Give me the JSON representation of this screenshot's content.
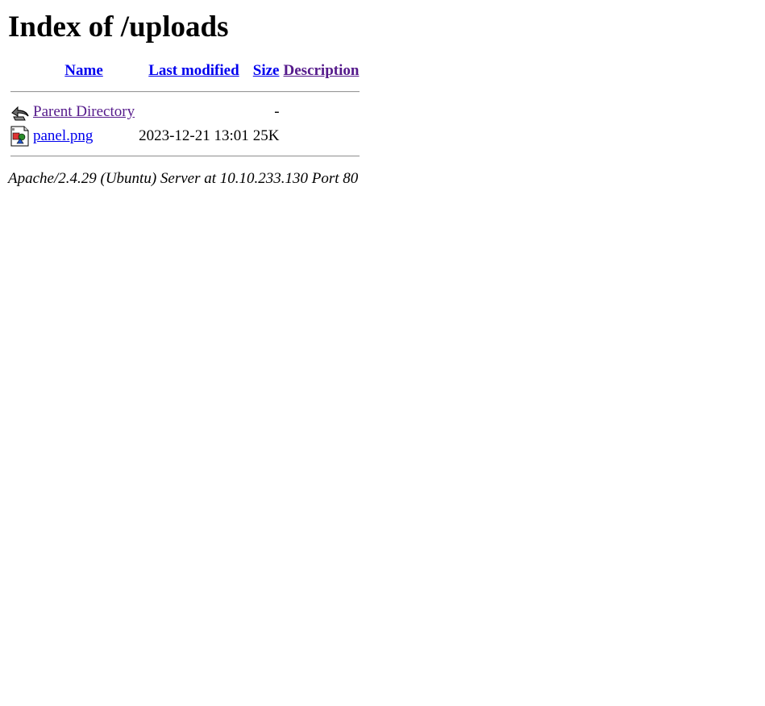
{
  "page": {
    "title": "Index of /uploads"
  },
  "table": {
    "headers": {
      "name": "Name",
      "last_modified": "Last modified",
      "size": "Size",
      "description": "Description"
    },
    "rows": [
      {
        "icon": "back-icon",
        "name": "Parent Directory",
        "last_modified": "",
        "size": "-",
        "description": ""
      },
      {
        "icon": "image-file-icon",
        "name": "panel.png",
        "last_modified": "2023-12-21 13:01",
        "size": "25K",
        "description": ""
      }
    ]
  },
  "footer": {
    "server_signature": "Apache/2.4.29 (Ubuntu) Server at 10.10.233.130 Port 80"
  },
  "colors": {
    "link": "#0000ee",
    "visited_link": "#551a8b",
    "text": "#000000",
    "background": "#ffffff"
  }
}
